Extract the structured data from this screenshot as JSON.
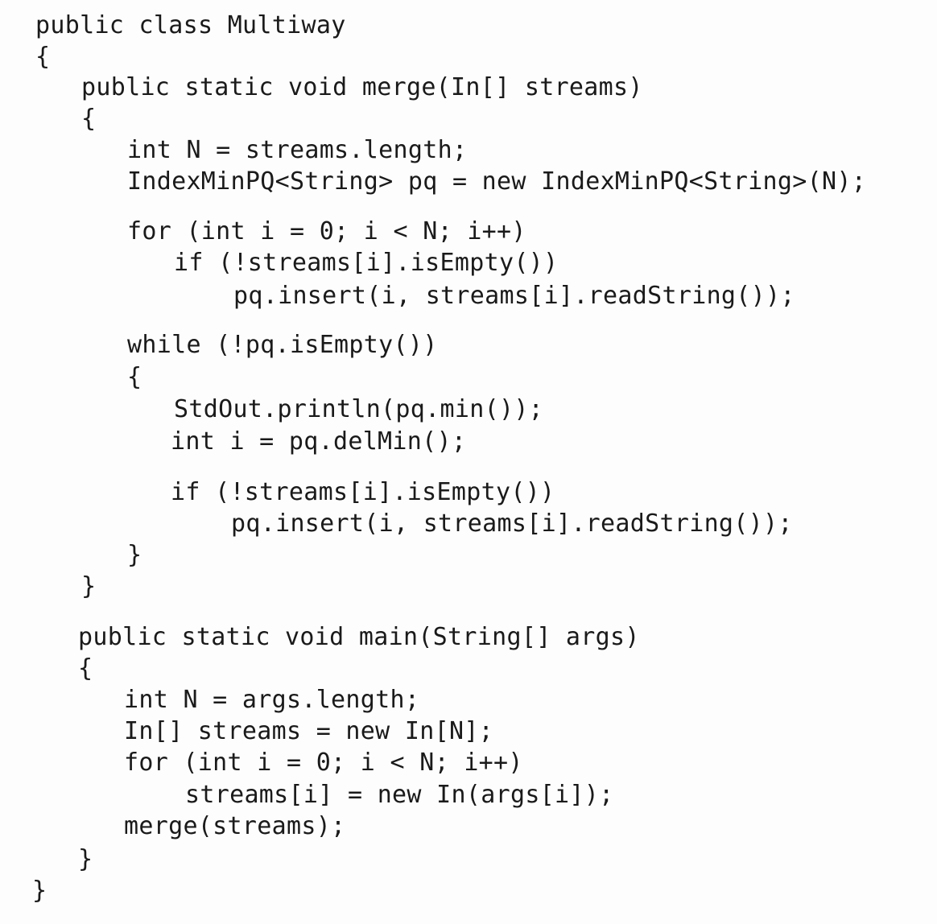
{
  "code": {
    "lines": [
      "public class Multiway",
      "{",
      "public static void merge(In[] streams)",
      "{",
      "int N = streams.length;",
      "IndexMinPQ<String> pq = new IndexMinPQ<String>(N);",
      "for (int i = 0; i < N; i++)",
      "if (!streams[i].isEmpty())",
      "pq.insert(i, streams[i].readString());",
      "while (!pq.isEmpty())",
      "{",
      "StdOut.println(pq.min());",
      "int i = pq.delMin();",
      "if (!streams[i].isEmpty())",
      "pq.insert(i, streams[i].readString());",
      "}",
      "}",
      "public static void main(String[] args)",
      "{",
      "int N = args.length;",
      "In[] streams = new In[N];",
      "for (int i = 0; i < N; i++)",
      "streams[i] = new In(args[i]);",
      "merge(streams);",
      "}",
      "}"
    ]
  }
}
